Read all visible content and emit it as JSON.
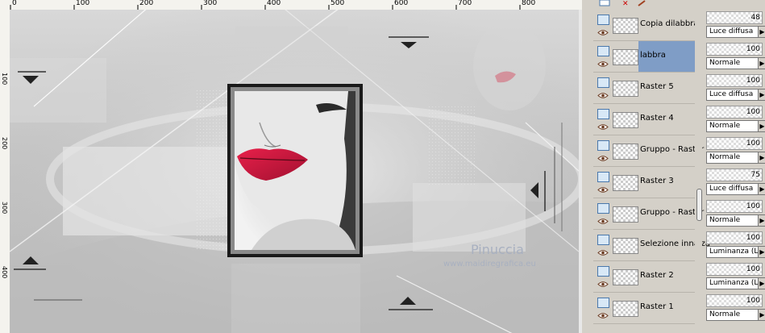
{
  "ruler": {
    "top_ticks": [
      "0",
      "100",
      "200",
      "300",
      "400",
      "500",
      "600",
      "700",
      "800"
    ],
    "left_ticks": [
      "100",
      "200",
      "300",
      "400"
    ]
  },
  "canvas": {
    "watermark_name": "Pinuccia",
    "watermark_url": "www.maidiregrafica.eu"
  },
  "layers": [
    {
      "name": "Copia dilabbra",
      "opacity": "48",
      "blend": "Luce diffusa",
      "selected": false
    },
    {
      "name": "labbra",
      "opacity": "100",
      "blend": "Normale",
      "selected": true
    },
    {
      "name": "Raster 5",
      "opacity": "100",
      "blend": "Luce diffusa",
      "selected": false
    },
    {
      "name": "Raster 4",
      "opacity": "100",
      "blend": "Normale",
      "selected": false
    },
    {
      "name": "Gruppo - Raster",
      "opacity": "100",
      "blend": "Normale",
      "selected": false
    },
    {
      "name": "Raster 3",
      "opacity": "75",
      "blend": "Luce diffusa",
      "selected": false
    },
    {
      "name": "Gruppo - Raster",
      "opacity": "100",
      "blend": "Normale",
      "selected": false
    },
    {
      "name": "Selezione innalza",
      "opacity": "100",
      "blend": "Luminanza (L)",
      "selected": false
    },
    {
      "name": "Raster 2",
      "opacity": "100",
      "blend": "Luminanza (L)",
      "selected": false
    },
    {
      "name": "Raster 1",
      "opacity": "100",
      "blend": "Normale",
      "selected": false
    }
  ],
  "colors": {
    "selected": "#7f9dc6",
    "lips": "#c8183a",
    "panel": "#d4d0c8"
  }
}
